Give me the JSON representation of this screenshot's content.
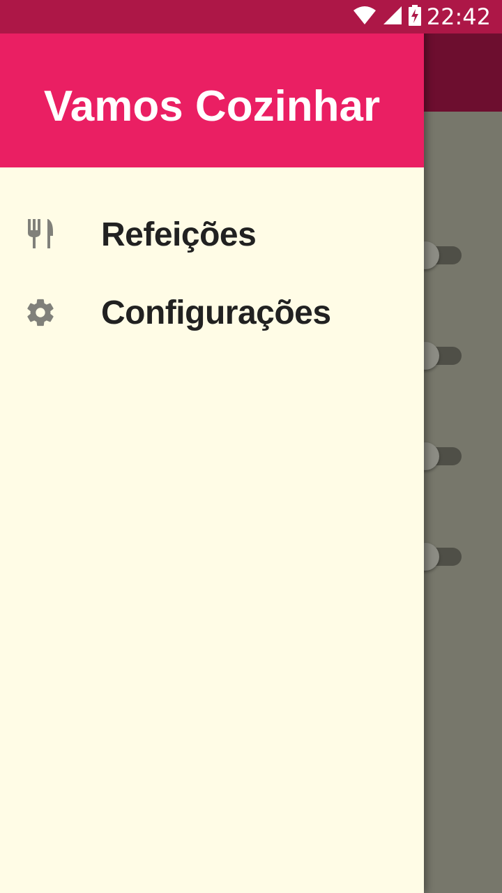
{
  "status_bar": {
    "time": "22:42",
    "icons": [
      "wifi-icon",
      "signal-icon",
      "battery-charging-icon"
    ]
  },
  "drawer": {
    "header_title": "Vamos Cozinhar",
    "menu_items": [
      {
        "label": "Refeições",
        "icon": "restaurant-icon"
      },
      {
        "label": "Configurações",
        "icon": "settings-gear-icon"
      }
    ]
  },
  "background_app": {
    "switches": [
      {
        "state": "off"
      },
      {
        "state": "off"
      },
      {
        "state": "off"
      },
      {
        "state": "off"
      }
    ]
  },
  "colors": {
    "status_bar": "#ad1747",
    "drawer_header": "#ea1f63",
    "drawer_background": "#fffce6",
    "scrim_app_bar": "#6d0e2f",
    "scrim_content": "#77776b",
    "menu_text": "#212121",
    "menu_icon": "#80807a"
  }
}
